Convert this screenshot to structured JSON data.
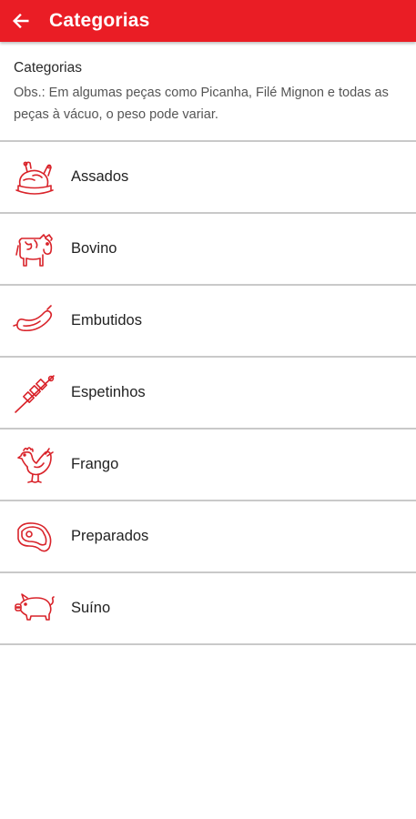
{
  "appbar": {
    "title": "Categorias",
    "back_icon": "arrow-left-icon",
    "color": "#ea1d25"
  },
  "header": {
    "title": "Categorias",
    "note": "Obs.: Em algumas peças como Picanha, Filé Mignon e todas as peças à vácuo, o peso pode variar."
  },
  "categories": [
    {
      "label": "Assados",
      "icon": "roast-chicken-icon"
    },
    {
      "label": "Bovino",
      "icon": "cow-icon"
    },
    {
      "label": "Embutidos",
      "icon": "sausage-icon"
    },
    {
      "label": "Espetinhos",
      "icon": "skewer-icon"
    },
    {
      "label": "Frango",
      "icon": "rooster-icon"
    },
    {
      "label": "Preparados",
      "icon": "steak-icon"
    },
    {
      "label": "Suíno",
      "icon": "pig-icon"
    }
  ]
}
